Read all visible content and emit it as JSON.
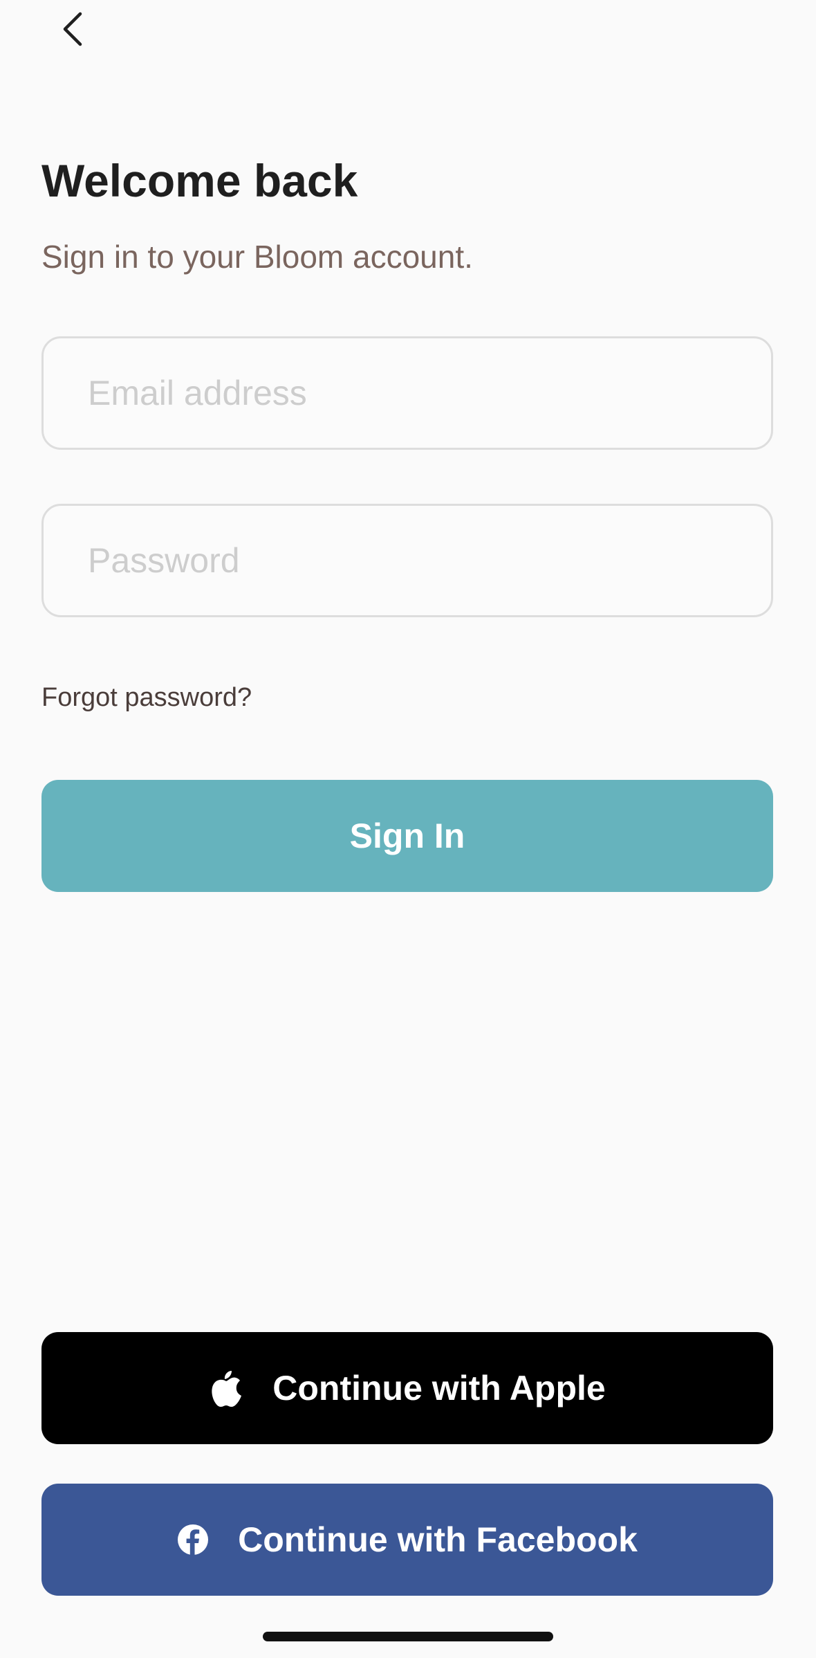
{
  "colors": {
    "background": "#fafafa",
    "sign_in_button": "#66b3bd",
    "apple_button": "#000000",
    "facebook_button": "#3b5796"
  },
  "nav": {
    "back_icon": "chevron-left-icon"
  },
  "header": {
    "title": "Welcome back",
    "subtitle": "Sign in to your Bloom account."
  },
  "form": {
    "email": {
      "placeholder": "Email address",
      "value": ""
    },
    "password": {
      "placeholder": "Password",
      "value": ""
    },
    "forgot_password_label": "Forgot password?",
    "sign_in_label": "Sign In"
  },
  "social": {
    "apple_label": "Continue with Apple",
    "apple_icon": "apple-logo-icon",
    "facebook_label": "Continue with Facebook",
    "facebook_icon": "facebook-logo-icon"
  }
}
